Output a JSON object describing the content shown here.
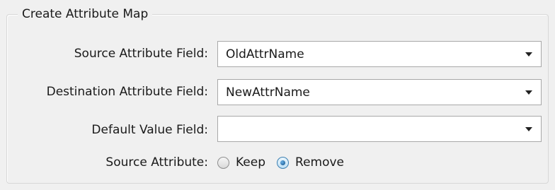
{
  "groupbox": {
    "title": "Create Attribute Map"
  },
  "source_field": {
    "label": "Source Attribute Field:",
    "value": "OldAttrName"
  },
  "destination_field": {
    "label": "Destination Attribute Field:",
    "value": "NewAttrName"
  },
  "default_value_field": {
    "label": "Default Value Field:",
    "value": ""
  },
  "source_attribute": {
    "label": "Source Attribute:",
    "options": [
      {
        "label": "Keep",
        "selected": false
      },
      {
        "label": "Remove",
        "selected": true
      }
    ]
  },
  "icons": {
    "dropdown": "chevron-down-icon"
  }
}
